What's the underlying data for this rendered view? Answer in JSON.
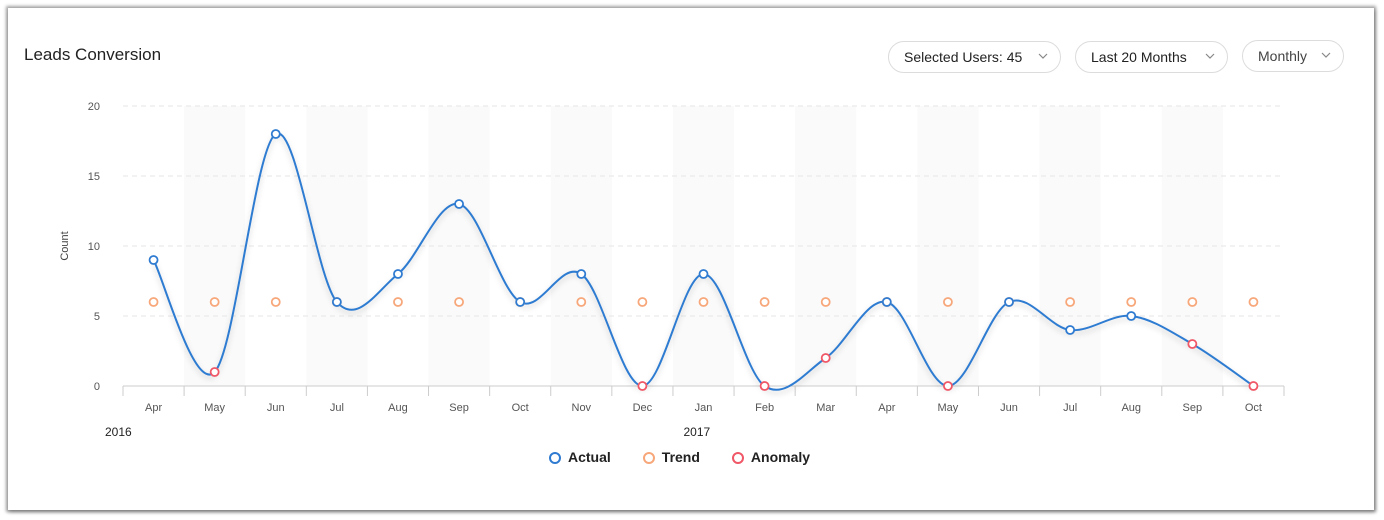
{
  "header": {
    "title": "Leads Conversion",
    "filters": {
      "users": "Selected Users: 45",
      "range": "Last 20 Months",
      "interval": "Monthly"
    }
  },
  "colors": {
    "actual": "#2f7bd1",
    "trend": "#f7a77a",
    "anomaly": "#f05767",
    "band": "#fafafa",
    "grid": "#e6e6e6",
    "axis": "#cccccc"
  },
  "icons": {
    "dropdown": "chevron-down-icon",
    "legend_marker": "circle-marker-icon"
  },
  "chart_data": {
    "type": "line",
    "title": "Leads Conversion",
    "xlabel": "",
    "ylabel": "Count",
    "ylim": [
      0,
      20
    ],
    "yticks": [
      0,
      5,
      10,
      15,
      20
    ],
    "grid": true,
    "categories": [
      "Apr",
      "May",
      "Jun",
      "Jul",
      "Aug",
      "Sep",
      "Oct",
      "Nov",
      "Dec",
      "Jan",
      "Feb",
      "Mar",
      "Apr",
      "May",
      "Jun",
      "Jul",
      "Aug",
      "Sep",
      "Oct"
    ],
    "year_labels": [
      {
        "label": "2016",
        "at_index": 0
      },
      {
        "label": "2017",
        "at_index": 9
      }
    ],
    "series": [
      {
        "name": "Actual",
        "values": [
          9,
          1,
          18,
          6,
          8,
          13,
          6,
          8,
          0,
          8,
          0,
          2,
          6,
          0,
          6,
          4,
          5,
          3,
          0
        ]
      },
      {
        "name": "Trend",
        "values": [
          6,
          6,
          6,
          6,
          6,
          6,
          6,
          6,
          6,
          6,
          6,
          6,
          6,
          6,
          6,
          6,
          6,
          6,
          6
        ]
      }
    ],
    "anomaly_indices": [
      1,
      8,
      10,
      11,
      13,
      17,
      18
    ],
    "legend": {
      "position": "bottom-center",
      "entries": [
        "Actual",
        "Trend",
        "Anomaly"
      ]
    }
  }
}
